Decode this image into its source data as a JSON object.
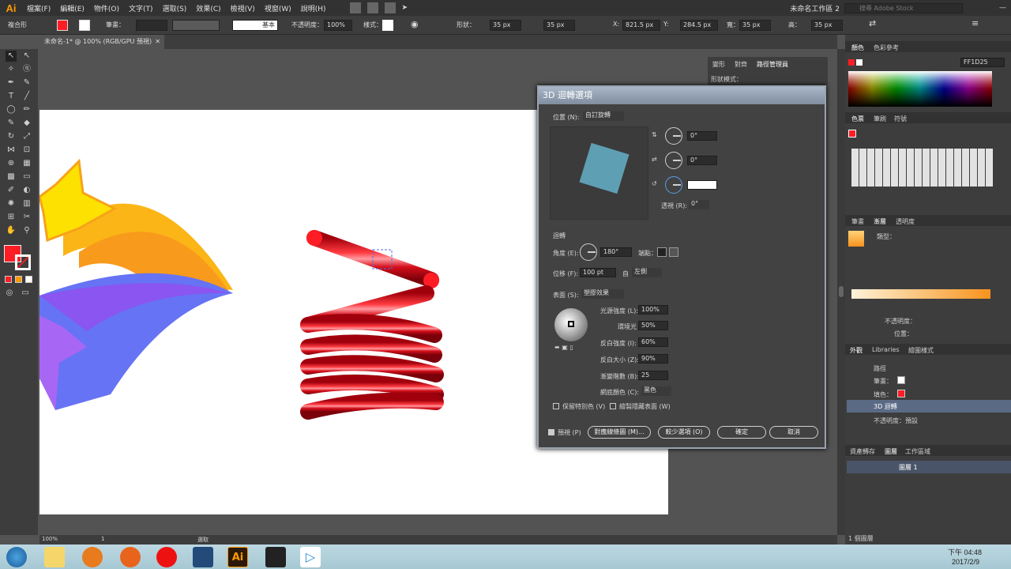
{
  "app": {
    "logo": "Ai",
    "menu": [
      "檔案(F)",
      "編輯(E)",
      "物件(O)",
      "文字(T)",
      "選取(S)",
      "效果(C)",
      "檢視(V)",
      "視窗(W)",
      "說明(H)"
    ],
    "workspace": "未命名工作區 2",
    "search_placeholder": "搜尋 Adobe Stock"
  },
  "control": {
    "selection": "複合形",
    "stroke_label": "筆畫：",
    "stroke_style": "基本",
    "opacity_label": "不透明度：",
    "opacity": "100%",
    "style_label": "樣式：",
    "shape_label": "形狀：",
    "w1": "35 px",
    "w2": "35 px",
    "x_label": "X:",
    "x": "821.5 px",
    "y_label": "Y:",
    "y": "284.5 px",
    "w_label": "寬：",
    "w": "35 px",
    "h_label": "高：",
    "h": "35 px"
  },
  "doc": {
    "tab": "未命名-1* @ 100% (RGB/GPU 預視)",
    "zoom": "100%",
    "artboard": "1",
    "status": "選取"
  },
  "midpanel": {
    "tabs": [
      "變形",
      "對齊",
      "路徑管理員"
    ],
    "shape_mode": "形狀模式："
  },
  "dialog": {
    "title": "3D 迴轉選項",
    "position_label": "位置 (N):",
    "position": "自訂旋轉",
    "rot_x": "0°",
    "rot_y": "0°",
    "rot_z": "",
    "perspective_label": "透視 (R):",
    "perspective": "0°",
    "revolve_label": "迴轉",
    "angle_label": "角度 (E):",
    "angle": "180°",
    "cap_label": "端點：",
    "offset_label": "位移 (F):",
    "offset": "100 pt",
    "from_label": "自",
    "from": "左側",
    "surface_label": "表面 (S):",
    "surface": "塑膠效果",
    "light_intensity_label": "光源強度 (L):",
    "light_intensity": "100%",
    "ambient_label": "環境光 (A):",
    "ambient": "50%",
    "highlight_intensity_label": "反白強度 (I):",
    "highlight_intensity": "60%",
    "highlight_size_label": "反白大小 (Z):",
    "highlight_size": "90%",
    "blend_steps_label": "漸變階數 (B):",
    "blend_steps": "25",
    "shading_label": "網底顏色 (C):",
    "shading": "黑色",
    "preserve_spot": "保留特別色 (V)",
    "draw_hidden": "繪製隱藏表面 (W)",
    "preview": "預視 (P)",
    "map_art": "對應線條圖 (M)...",
    "fewer": "較少選項 (O)",
    "ok": "確定",
    "cancel": "取消"
  },
  "color_panel": {
    "tabs": [
      "顏色",
      "色彩參考"
    ],
    "hex": "FF1D25"
  },
  "swatches_panel": {
    "tabs": [
      "色票",
      "筆刷",
      "符號"
    ]
  },
  "gradient_panel": {
    "tabs": [
      "筆畫",
      "漸層",
      "透明度"
    ],
    "type_label": "類型：",
    "opacity_label": "不透明度：",
    "position_label": "位置："
  },
  "appearance_panel": {
    "tabs": [
      "外觀",
      "Libraries",
      "繪圖樣式"
    ],
    "path": "路徑",
    "stroke": "筆畫：",
    "fill": "填色：",
    "effect": "3D 迴轉",
    "opacity": "不透明度：預設"
  },
  "layers_panel": {
    "tabs": [
      "資產轉存",
      "圖層",
      "工作區域"
    ],
    "layer": "圖層 1",
    "count": "1 個圖層"
  },
  "taskbar": {
    "time": "下午 04:48",
    "date": "2017/2/9"
  },
  "colors": {
    "accent": "#ff1d25",
    "swatch_highlight": "#5a6a85"
  }
}
